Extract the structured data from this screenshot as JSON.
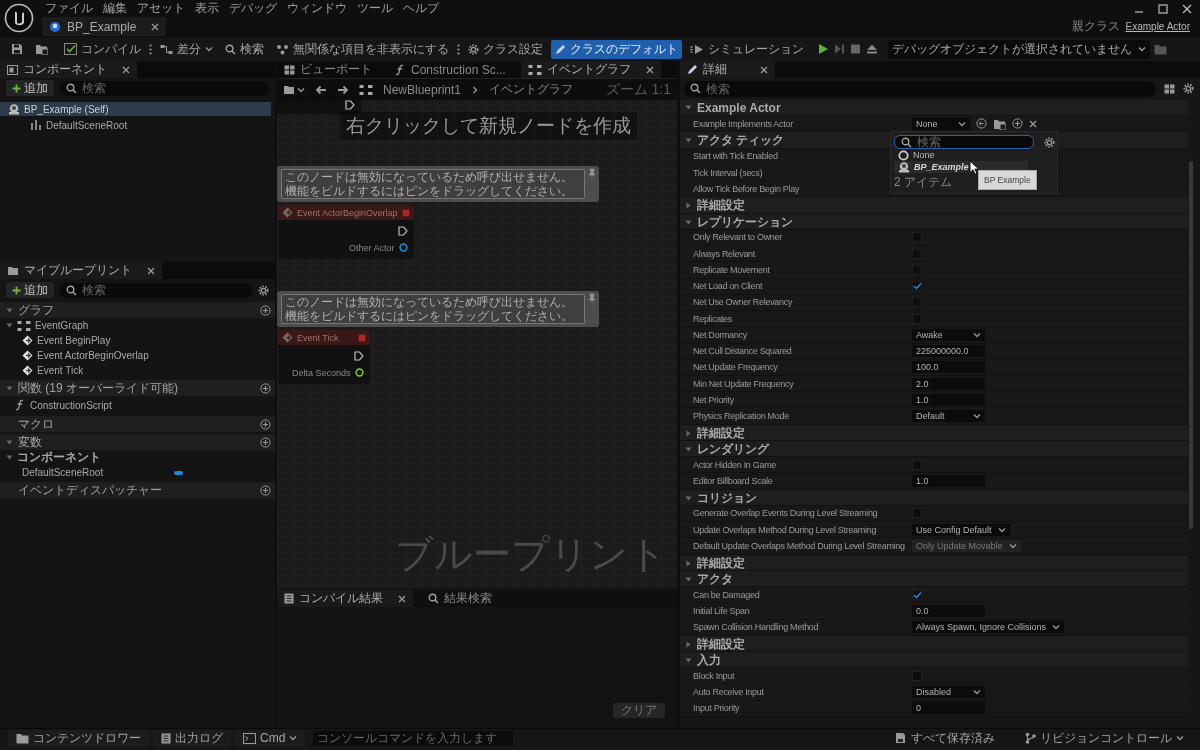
{
  "menu": [
    "ファイル",
    "編集",
    "アセット",
    "表示",
    "デバッグ",
    "ウィンドウ",
    "ツール",
    "ヘルプ"
  ],
  "document_tab": {
    "label": "BP_Example",
    "selected": true
  },
  "parent_class": {
    "label": "親クラス",
    "value": "Example Actor"
  },
  "toolbar": [
    {
      "kind": "button",
      "label": "コンパイル",
      "more": true
    },
    {
      "kind": "dropdown",
      "label": "差分",
      "more": false
    },
    {
      "kind": "button",
      "label": "検索",
      "more": false
    },
    {
      "kind": "button",
      "label": "無関係な項目を非表示にする",
      "more": true
    },
    {
      "kind": "toggle",
      "label": "クラス設定",
      "selected": false,
      "more": false
    },
    {
      "kind": "toggle",
      "label": "クラスのデフォルト",
      "selected": true,
      "more": false
    },
    {
      "kind": "button",
      "label": "シミュレーション",
      "more": false
    }
  ],
  "debug_object": "デバッグオブジェクトが選択されていません",
  "components": {
    "title": "コンポーネント",
    "add": "追加",
    "search_placeholder": "検索",
    "tree": [
      {
        "label": "BP_Example (Self)",
        "selected": true,
        "children": [
          {
            "label": "DefaultSceneRoot",
            "selected": false
          }
        ]
      }
    ]
  },
  "my_blueprint": {
    "title": "マイブループリント",
    "add": "追加",
    "search_placeholder": "検索",
    "sections": [
      {
        "label": "グラフ",
        "items": [
          {
            "label": "EventGraph",
            "kind": "graph",
            "children": [
              {
                "label": "Event BeginPlay",
                "kind": "event"
              },
              {
                "label": "Event ActorBeginOverlap",
                "kind": "event"
              },
              {
                "label": "Event Tick",
                "kind": "event"
              }
            ]
          }
        ]
      },
      {
        "label": "関数 (19 オーバーライド可能)",
        "items": [
          {
            "label": "ConstructionScript",
            "kind": "function"
          }
        ]
      },
      {
        "label": "マクロ"
      },
      {
        "label": "変数",
        "items": [
          {
            "label": "コンポーネント",
            "kind": "category",
            "children": [
              {
                "label": "DefaultSceneRoot",
                "kind": "variable",
                "color": "#1a8ad4"
              }
            ]
          }
        ]
      },
      {
        "label": "イベントディスパッチャー"
      }
    ]
  },
  "center_tabs": [
    {
      "label": "ビューポート",
      "selected": false
    },
    {
      "label": "Construction Sc...",
      "selected": false
    },
    {
      "label": "イベントグラフ",
      "selected": true
    }
  ],
  "graph": {
    "breadcrumb": [
      "NewBlueprint1",
      "イベントグラフ"
    ],
    "zoom": "ズーム 1:1",
    "hint": "右クリックして新規ノードを作成",
    "watermark": "ブループリント",
    "nodes": [
      {
        "title": "Event ActorBeginOverlap",
        "comment_lines": [
          "このノードは無効になっているため呼び出せません。",
          "機能をビルドするにはピンをドラッグしてください。"
        ],
        "pins": [
          {
            "kind": "exec"
          },
          {
            "kind": "object",
            "label": "Other Actor"
          }
        ]
      },
      {
        "title": "Event Tick",
        "comment_lines": [
          "このノードは無効になっているため呼び出せません。",
          "機能をビルドするにはピンをドラッグしてください。"
        ],
        "pins": [
          {
            "kind": "exec"
          },
          {
            "kind": "float",
            "label": "Delta Seconds"
          }
        ]
      }
    ]
  },
  "results": {
    "tabs": [
      {
        "label": "コンパイル結果",
        "selected": true
      },
      {
        "label": "結果検索",
        "selected": false
      }
    ],
    "clear": "クリア"
  },
  "details": {
    "title": "詳細",
    "search_placeholder": "検索",
    "rows": [
      {
        "kind": "section",
        "label": "Example Actor",
        "expanded": true
      },
      {
        "kind": "object",
        "label": "Example Implements Actor",
        "value": "None"
      },
      {
        "kind": "section",
        "label": "アクタ ティック",
        "expanded": true
      },
      {
        "kind": "property",
        "label": "Start with Tick Enabled"
      },
      {
        "kind": "property",
        "label": "Tick Interval (secs)"
      },
      {
        "kind": "property",
        "label": "Allow Tick Before Begin Play"
      },
      {
        "kind": "section",
        "label": "詳細設定",
        "expanded": false
      },
      {
        "kind": "section",
        "label": "レプリケーション",
        "expanded": true
      },
      {
        "kind": "checkbox",
        "label": "Only Relevant to Owner",
        "checked": false
      },
      {
        "kind": "checkbox",
        "label": "Always Relevant",
        "checked": false
      },
      {
        "kind": "checkbox",
        "label": "Replicate Movement",
        "checked": false
      },
      {
        "kind": "checkbox",
        "label": "Net Load on Client",
        "checked": true
      },
      {
        "kind": "checkbox",
        "label": "Net Use Owner Relevancy",
        "checked": false
      },
      {
        "kind": "checkbox",
        "label": "Replicates",
        "checked": false
      },
      {
        "kind": "dropdown",
        "label": "Net Dormancy",
        "value": "Awake",
        "disabled": false
      },
      {
        "kind": "number",
        "label": "Net Cull Distance Squared",
        "value": "225000000.0"
      },
      {
        "kind": "number",
        "label": "Net Update Frequency",
        "value": "100.0"
      },
      {
        "kind": "number",
        "label": "Min Net Update Frequency",
        "value": "2.0"
      },
      {
        "kind": "number",
        "label": "Net Priority",
        "value": "1.0"
      },
      {
        "kind": "dropdown",
        "label": "Physics Replication Mode",
        "value": "Default",
        "disabled": false
      },
      {
        "kind": "section",
        "label": "詳細設定",
        "expanded": false
      },
      {
        "kind": "section",
        "label": "レンダリング",
        "expanded": true
      },
      {
        "kind": "checkbox",
        "label": "Actor Hidden In Game",
        "checked": false
      },
      {
        "kind": "number",
        "label": "Editor Billboard Scale",
        "value": "1.0"
      },
      {
        "kind": "section",
        "label": "コリジョン",
        "expanded": true
      },
      {
        "kind": "checkbox",
        "label": "Generate Overlap Events During Level Streaming",
        "checked": false
      },
      {
        "kind": "dropdown",
        "label": "Update Overlaps Method During Level Streaming",
        "value": "Use Config Default",
        "disabled": false
      },
      {
        "kind": "dropdown",
        "label": "Default Update Overlaps Method During Level Streaming",
        "value": "Only Update Movable",
        "disabled": true
      },
      {
        "kind": "section",
        "label": "詳細設定",
        "expanded": false
      },
      {
        "kind": "section",
        "label": "アクタ",
        "expanded": true
      },
      {
        "kind": "checkbox",
        "label": "Can be Damaged",
        "checked": true
      },
      {
        "kind": "number",
        "label": "Initial Life Span",
        "value": "0.0"
      },
      {
        "kind": "dropdown",
        "label": "Spawn Collision Handling Method",
        "value": "Always Spawn, Ignore Collisions",
        "disabled": false
      },
      {
        "kind": "section",
        "label": "詳細設定",
        "expanded": false
      },
      {
        "kind": "section",
        "label": "入力",
        "expanded": true
      },
      {
        "kind": "checkbox",
        "label": "Block Input",
        "checked": false
      },
      {
        "kind": "dropdown",
        "label": "Auto Receive Input",
        "value": "Disabled",
        "disabled": false
      },
      {
        "kind": "number",
        "label": "Input Priority",
        "value": "0"
      }
    ],
    "popup": {
      "search_placeholder": "検索",
      "options": [
        {
          "label": "None",
          "selected": false
        },
        {
          "label": "BP_Example",
          "selected": true
        }
      ],
      "count": "2 アイテム",
      "tooltip": "BP Example"
    }
  },
  "status_bar": {
    "items": [
      "コンテンツドロワー",
      "出力ログ"
    ],
    "cmd": "Cmd",
    "console_placeholder": "コンソールコマンドを入力します",
    "save_status": "すべて保存済み",
    "revision": "リビジョンコントロール"
  }
}
